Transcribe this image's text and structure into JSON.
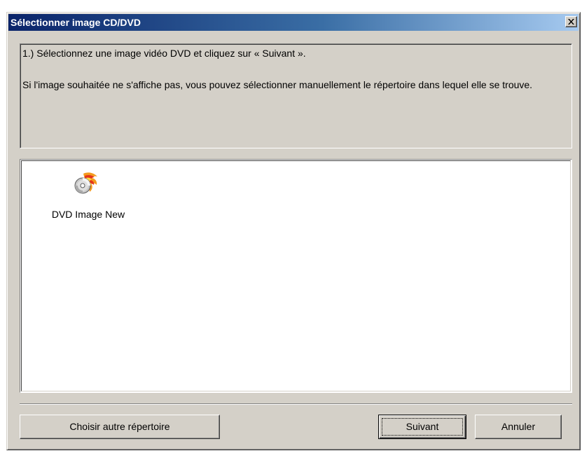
{
  "window": {
    "title": "Sélectionner image CD/DVD",
    "close_icon": "close-icon"
  },
  "info": {
    "line1": "1.) Sélectionnez une image vidéo DVD et cliquez sur « Suivant ».",
    "line2": "Si l'image souhaitée ne s'affiche pas, vous pouvez sélectionner manuellement le répertoire dans lequel elle se trouve."
  },
  "list": {
    "items": [
      {
        "label": "DVD Image New",
        "icon": "flaming-disc-icon"
      }
    ]
  },
  "buttons": {
    "choose_dir": "Choisir autre répertoire",
    "next": "Suivant",
    "cancel": "Annuler"
  },
  "colors": {
    "titlebar_start": "#0a246a",
    "titlebar_end": "#a6caf0",
    "face": "#d4d0c8"
  }
}
